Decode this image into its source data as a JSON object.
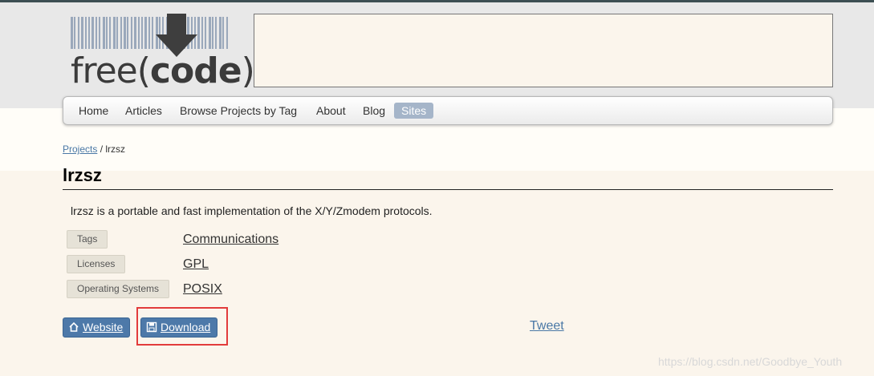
{
  "logo": {
    "text_pre": "free(",
    "text_bold": "code",
    "text_post": "):"
  },
  "nav": {
    "items": [
      {
        "label": "Home"
      },
      {
        "label": "Articles"
      },
      {
        "label": "Browse Projects by Tag"
      },
      {
        "label": "About"
      },
      {
        "label": "Blog"
      },
      {
        "label": "Sites",
        "active": true
      }
    ]
  },
  "breadcrumb": {
    "link": "Projects",
    "separator": "/",
    "current": "lrzsz"
  },
  "project": {
    "title": "lrzsz",
    "description": "lrzsz is a portable and fast implementation of the X/Y/Zmodem protocols.",
    "meta": [
      {
        "label": "Tags",
        "value": "Communications"
      },
      {
        "label": "Licenses",
        "value": "GPL"
      },
      {
        "label": "Operating Systems",
        "value": "POSIX"
      }
    ]
  },
  "actions": {
    "website_label": "Website",
    "website_icon": "home-icon",
    "download_label": "Download",
    "download_icon": "floppy-disk-icon",
    "tweet_label": "Tweet"
  },
  "watermark": "https://blog.csdn.net/Goodbye_Youth",
  "colors": {
    "accent": "#4d79a9",
    "active_nav": "#a5b5c9",
    "highlight": "#e23b3b",
    "page_bg": "#fbf5ec"
  }
}
